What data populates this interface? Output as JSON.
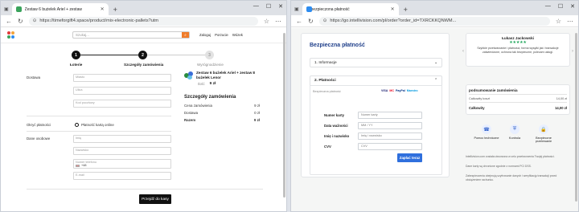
{
  "left_window": {
    "tab_title": "Zestaw 6 bużelek Ariel + zestaw",
    "url": "https://timeforgift4.space/product/mix-electronic-pallets?utm",
    "search_placeholder": "Szukaj...",
    "header_links": [
      "Zaloguj",
      "Porzucie",
      "Wózek"
    ],
    "steps": [
      "Łoterie",
      "Szczegóły zamówienia",
      "Wyrógnodzienie"
    ],
    "step_numbers": [
      "1",
      "2",
      "3"
    ],
    "form": {
      "section_shipping": "Dostawa",
      "shipping_fields": [
        "Miasto",
        "Ulica",
        "Kod pocztowy"
      ],
      "section_payment": "Okryć płatności",
      "payment_option": "Płatność kartą online",
      "section_contact": "Dane osobowe",
      "contact_fields": [
        "Imię",
        "Nazwisko",
        "Numer telefonu",
        "E-mail"
      ],
      "phone_prefix": "+48"
    },
    "product": {
      "title": "Zestaw 6 bużelek Ariel + zestaw 8 bużelek Lenor",
      "qty_label": "Ilość",
      "price": "9 zł"
    },
    "summary": {
      "title": "Szczegóły zamówienia",
      "rows": [
        {
          "label": "Cena zamówienia",
          "value": "9 zł"
        },
        {
          "label": "Dostawa",
          "value": "0 zł"
        },
        {
          "label": "Razem",
          "value": "9 zł"
        }
      ]
    },
    "submit": "Przejdź do kasy"
  },
  "right_window": {
    "tab_title": "Zabezpieczona płatność",
    "url": "https://go.intellivision.com/pl/order?order_id=TXRCKKQNWM...",
    "page_title": "Bezpieczna płatność",
    "accordion": [
      "1. Informacje",
      "2. Płatności"
    ],
    "payment_note": "Bezpieczna płatność",
    "card_brands": [
      "VISA",
      "MC",
      "PayPal",
      "Maestro"
    ],
    "fields": [
      {
        "label": "Numer karty",
        "placeholder": "Numer karty"
      },
      {
        "label": "Data ważności",
        "placeholder": "MM / YY"
      },
      {
        "label": "Imię i nazwisko",
        "placeholder": "Imię i nazwisko"
      },
      {
        "label": "CVV",
        "placeholder": "CVV"
      }
    ],
    "pay_button": "Zapłać teraz",
    "review": {
      "name": "Łukasz Jackowski",
      "stars": "★★★★★",
      "text": "Szybkie przetwarzanie i płatności, forma wysyłki jak i transakcje zatwierdzone, ochrona tak bezpieczne, polecam usługi."
    },
    "order_summary": {
      "title": "podsumowanie zamówienia",
      "rows": [
        {
          "label": "Całkowity koszt",
          "value": "14,00 zł"
        },
        {
          "label": "Całkowity",
          "value": "14,00 zł"
        }
      ]
    },
    "badges": [
      "Pomoc techniczne",
      "Kontrola",
      "Bezpieczne przelewanie"
    ],
    "fine_print": [
      "Intellivision.com została utworzona w celu przetworzenia Twojej płatności.",
      "Dane karty są chronione zgodnie z normami PCI DSS.",
      "Zabezpieczenia obejmują szyfrowanie danych i weryfikację transakcji przed obciążeniem rachunku."
    ]
  }
}
